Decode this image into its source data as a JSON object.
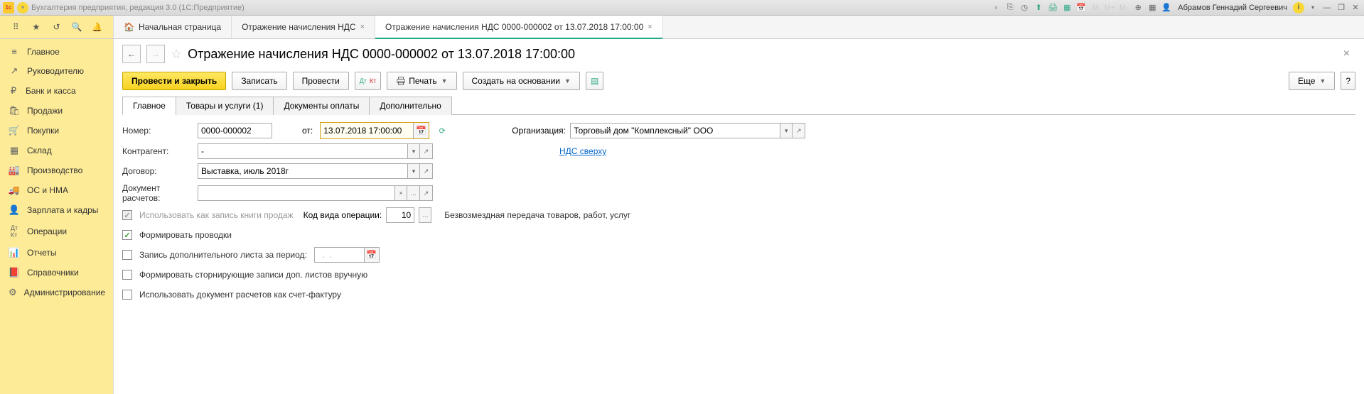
{
  "titlebar": {
    "app_title": "Бухгалтерия предприятия, редакция 3.0  (1С:Предприятие)",
    "user": "Абрамов Геннадий Сергеевич"
  },
  "tabs": {
    "home": "Начальная страница",
    "tab1": "Отражение начисления НДС",
    "tab2": "Отражение начисления НДС 0000-000002 от 13.07.2018 17:00:00"
  },
  "sidebar": {
    "items": [
      {
        "label": "Главное",
        "icon": "≡"
      },
      {
        "label": "Руководителю",
        "icon": "↗"
      },
      {
        "label": "Банк и касса",
        "icon": "₽"
      },
      {
        "label": "Продажи",
        "icon": "🛒"
      },
      {
        "label": "Покупки",
        "icon": "🛒"
      },
      {
        "label": "Склад",
        "icon": "▦"
      },
      {
        "label": "Производство",
        "icon": "⚙"
      },
      {
        "label": "ОС и НМА",
        "icon": "🚚"
      },
      {
        "label": "Зарплата и кадры",
        "icon": "👤"
      },
      {
        "label": "Операции",
        "icon": "Дт"
      },
      {
        "label": "Отчеты",
        "icon": "📊"
      },
      {
        "label": "Справочники",
        "icon": "📕"
      },
      {
        "label": "Администрирование",
        "icon": "⚙"
      }
    ]
  },
  "page": {
    "title": "Отражение начисления НДС 0000-000002 от 13.07.2018 17:00:00"
  },
  "toolbar": {
    "post_and_close": "Провести и закрыть",
    "save": "Записать",
    "post": "Провести",
    "print": "Печать",
    "create_based": "Создать на основании",
    "more": "Еще",
    "help": "?"
  },
  "doc_tabs": {
    "main": "Главное",
    "goods": "Товары и услуги (1)",
    "payment_docs": "Документы оплаты",
    "additional": "Дополнительно"
  },
  "form": {
    "number_label": "Номер:",
    "number_value": "0000-000002",
    "from_label": "от:",
    "date_value": "13.07.2018 17:00:00",
    "org_label": "Организация:",
    "org_value": "Торговый дом \"Комплексный\" ООО",
    "counterparty_label": "Контрагент:",
    "counterparty_value": "-",
    "vat_link": "НДС сверху",
    "contract_label": "Договор:",
    "contract_value": "Выставка, июль 2018г",
    "settlement_doc_label": "Документ расчетов:",
    "settlement_doc_value": "",
    "use_as_sales_book": "Использовать как запись книги продаж",
    "op_code_label": "Код вида операции:",
    "op_code_value": "10",
    "op_code_hint": "Безвозмездная передача товаров, работ, услуг",
    "form_postings": "Формировать проводки",
    "additional_sheet": "Запись дополнительного листа за период:",
    "additional_sheet_date": "  .  .",
    "form_reversal": "Формировать сторнирующие записи доп. листов вручную",
    "use_settlement_doc": "Использовать документ расчетов как счет-фактуру"
  }
}
